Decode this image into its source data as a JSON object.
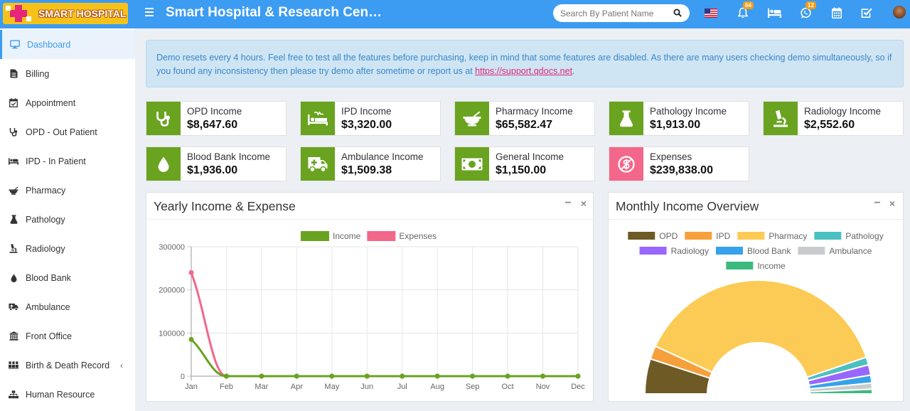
{
  "header": {
    "logo_text": "SMART HOSPITAL",
    "title": "Smart Hospital & Research Cen…",
    "search_placeholder": "Search By Patient Name",
    "notifications_count": "64",
    "whatsapp_count": "12",
    "icons": [
      "flag-us-icon",
      "bell-icon",
      "bed-icon",
      "whatsapp-icon",
      "calendar-icon",
      "checkbox-icon",
      "avatar"
    ]
  },
  "sidebar": {
    "items": [
      {
        "label": "Dashboard",
        "icon": "monitor-icon",
        "active": true
      },
      {
        "label": "Billing",
        "icon": "file-icon"
      },
      {
        "label": "Appointment",
        "icon": "calendar-check-icon"
      },
      {
        "label": "OPD - Out Patient",
        "icon": "stethoscope-icon"
      },
      {
        "label": "IPD - In Patient",
        "icon": "bed-icon"
      },
      {
        "label": "Pharmacy",
        "icon": "mortar-pestle-icon"
      },
      {
        "label": "Pathology",
        "icon": "flask-icon"
      },
      {
        "label": "Radiology",
        "icon": "microscope-icon"
      },
      {
        "label": "Blood Bank",
        "icon": "tint-icon"
      },
      {
        "label": "Ambulance",
        "icon": "ambulance-icon"
      },
      {
        "label": "Front Office",
        "icon": "building-icon"
      },
      {
        "label": "Birth & Death Record",
        "icon": "users-icon",
        "chevron": "‹"
      },
      {
        "label": "Human Resource",
        "icon": "sitemap-icon"
      }
    ]
  },
  "alert": {
    "text": "Demo resets every 4 hours. Feel free to test all the features before purchasing, keep in mind that some features are disabled. As there are many users checking demo simultaneously, so if you found any inconsistency then please try demo after sometime or report us at ",
    "link": "https://support.qdocs.net",
    "suffix": "."
  },
  "cards": [
    {
      "label": "OPD Income",
      "value": "$8,647.60",
      "color": "#69a320",
      "icon": "stethoscope-icon"
    },
    {
      "label": "IPD Income",
      "value": "$3,320.00",
      "color": "#69a320",
      "icon": "procedures-icon"
    },
    {
      "label": "Pharmacy Income",
      "value": "$65,582.47",
      "color": "#69a320",
      "icon": "mortar-pestle-icon"
    },
    {
      "label": "Pathology Income",
      "value": "$1,913.00",
      "color": "#69a320",
      "icon": "flask-icon"
    },
    {
      "label": "Radiology Income",
      "value": "$2,552.60",
      "color": "#69a320",
      "icon": "microscope-icon"
    },
    {
      "label": "Blood Bank Income",
      "value": "$1,936.00",
      "color": "#69a320",
      "icon": "tint-icon"
    },
    {
      "label": "Ambulance Income",
      "value": "$1,509.38",
      "color": "#69a320",
      "icon": "ambulance-icon"
    },
    {
      "label": "General Income",
      "value": "$1,150.00",
      "color": "#69a320",
      "icon": "money-bill-icon"
    },
    {
      "label": "Expenses",
      "value": "$239,838.00",
      "color": "#f3678a",
      "icon": "dollar-slash-icon"
    }
  ],
  "yearly_panel": {
    "title": "Yearly Income & Expense",
    "minimize": "−",
    "close": "×"
  },
  "monthly_panel": {
    "title": "Monthly Income Overview",
    "minimize": "−",
    "close": "×"
  },
  "chart_data": [
    {
      "type": "line",
      "title": "",
      "categories": [
        "Jan",
        "Feb",
        "Mar",
        "Apr",
        "May",
        "Jun",
        "Jul",
        "Aug",
        "Sep",
        "Oct",
        "Nov",
        "Dec"
      ],
      "ylim": [
        0,
        300000
      ],
      "yticks": [
        "300000",
        "200000",
        "100000",
        "0"
      ],
      "grid": true,
      "legend": "top",
      "series": [
        {
          "name": "Income",
          "color": "#69a320",
          "values": [
            85000,
            0,
            0,
            0,
            0,
            0,
            0,
            0,
            0,
            0,
            0,
            0
          ]
        },
        {
          "name": "Expenses",
          "color": "#f3678a",
          "values": [
            240000,
            0,
            0,
            0,
            0,
            0,
            0,
            0,
            0,
            0,
            0,
            0
          ]
        }
      ]
    },
    {
      "type": "pie",
      "subtype": "half-doughnut",
      "title": "",
      "legend": "top",
      "slices": [
        {
          "name": "OPD",
          "color": "#6e5a25",
          "value": 8647.6
        },
        {
          "name": "IPD",
          "color": "#f6a03c",
          "value": 3320.0
        },
        {
          "name": "Pharmacy",
          "color": "#fccb55",
          "value": 65582.47
        },
        {
          "name": "Pathology",
          "color": "#4bc0c0",
          "value": 1913.0
        },
        {
          "name": "Radiology",
          "color": "#9966ff",
          "value": 2552.6
        },
        {
          "name": "Blood Bank",
          "color": "#36a2eb",
          "value": 1936.0
        },
        {
          "name": "Ambulance",
          "color": "#c9cbcf",
          "value": 1509.38
        },
        {
          "name": "Income",
          "color": "#3cba7e",
          "value": 1150.0
        }
      ]
    }
  ]
}
